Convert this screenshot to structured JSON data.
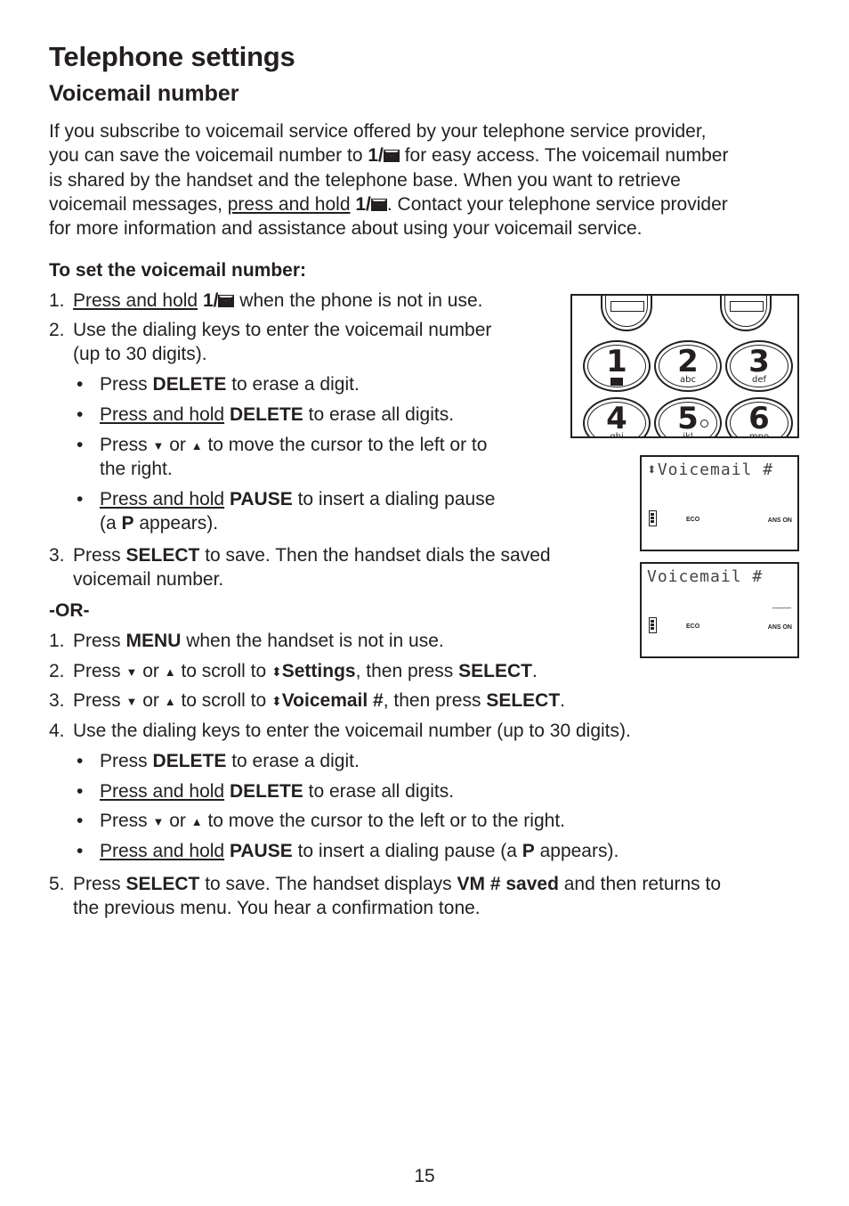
{
  "page": {
    "title": "Telephone settings",
    "section_title": "Voicemail number",
    "page_number": "15"
  },
  "intro": {
    "l1": "If you subscribe to voicemail service offered by your telephone service provider,",
    "l2a": "you can save the voicemail number to ",
    "key1": "1/",
    "l2b": " for easy access. The voicemail number",
    "l3": "is shared by the handset and the telephone base. When you want to retrieve",
    "l4a": "voicemail messages, ",
    "l4u": "press and hold",
    "l4b": ". Contact your telephone service provider",
    "l5": "for more information and assistance about using your voicemail service."
  },
  "procedure": {
    "heading": "To set the voicemail number:",
    "or_label": "-OR-",
    "press_and_hold": "Press and hold",
    "press": "Press",
    "method1": {
      "s1_num": "1.",
      "s1_tail": " when the phone is not in use.",
      "s2_num": "2.",
      "s2_l1": "Use the dialing keys to enter the voicemail number",
      "s2_l2": "(up to 30 digits).",
      "b1_tail": " to erase a digit.",
      "b2_tail": " to erase all digits.",
      "b3_mid": " or ",
      "b3_tail": " to move the cursor to the left or to",
      "b3_l2": "the right.",
      "b4_tail": " to insert a dialing pause",
      "b4_l2a": "(a ",
      "b4_l2b": " appears).",
      "s3_num": "3.",
      "s3_tail": " to save. Then the handset dials the saved",
      "s3_l2": "voicemail number."
    },
    "method2": {
      "s1": "1.",
      "s1_tail": " when the handset is not in use.",
      "s2": "2.",
      "scroll_to": " to scroll to ",
      "s2_target": "Settings",
      "then_press": ", then press ",
      "s3": "3.",
      "s3_target": "Voicemail #",
      "s4": "4.",
      "s4_text": "Use the dialing keys to enter the voicemail number (up to 30 digits).",
      "b3_tail": " to move the cursor to the left or to the right.",
      "b4_tail": " to insert a dialing pause (a ",
      "b4_end": " appears).",
      "s5": "5.",
      "s5_mid": " to save. The handset displays ",
      "s5_saved": "VM # saved",
      "s5_tail": " and then returns to",
      "s5_l2": "the previous menu. You hear a confirmation tone."
    },
    "keys": {
      "delete": "DELETE",
      "pause": "PAUSE",
      "select": "SELECT",
      "menu": "MENU",
      "p": "P",
      "or": " or ",
      "period": "."
    }
  },
  "icons": {
    "down": "▼",
    "up": "▲",
    "updown": "⬍",
    "bullet": "•"
  },
  "keypad": {
    "keys": [
      {
        "digit": "1",
        "letters": ""
      },
      {
        "digit": "2",
        "letters": "abc"
      },
      {
        "digit": "3",
        "letters": "def"
      },
      {
        "digit": "4",
        "letters": "ghi"
      },
      {
        "digit": "5",
        "letters": "jkl"
      },
      {
        "digit": "6",
        "letters": "mno"
      }
    ]
  },
  "screens": [
    {
      "title": "⬍Voicemail #",
      "cursor": "",
      "eco": "ECO",
      "ans": "ANS ON"
    },
    {
      "title": "Voicemail #",
      "cursor": "_____",
      "eco": "ECO",
      "ans": "ANS ON"
    }
  ]
}
